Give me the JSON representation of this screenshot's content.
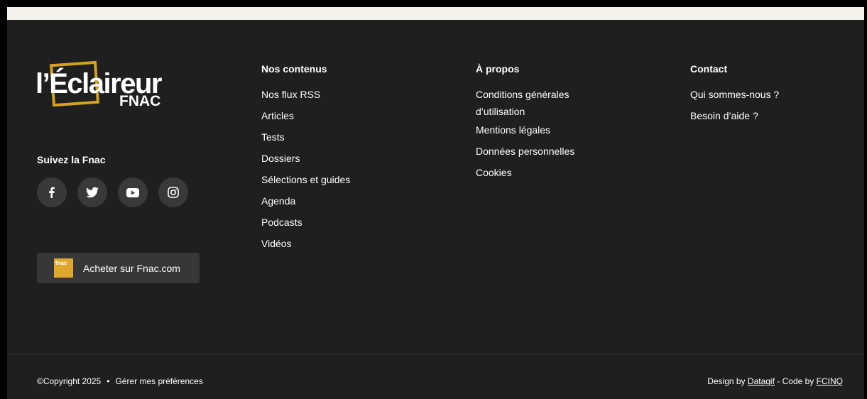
{
  "logo": {
    "main": "l’Éclaireur",
    "sub": "FNAC"
  },
  "follow": {
    "title": "Suivez la Fnac",
    "icons": [
      "facebook-icon",
      "twitter-icon",
      "youtube-icon",
      "instagram-icon"
    ]
  },
  "buy_button": {
    "badge": "fnac",
    "label": "Acheter sur Fnac.com"
  },
  "columns": {
    "contenus": {
      "title": "Nos contenus",
      "items": [
        "Nos flux RSS",
        "Articles",
        "Tests",
        "Dossiers",
        "Sélections et guides",
        "Agenda",
        "Podcasts",
        "Vidéos"
      ]
    },
    "apropos": {
      "title": "À propos",
      "items": [
        "Conditions générales d’utilisation",
        "Mentions légales",
        "Données personnelles",
        "Cookies"
      ]
    },
    "contact": {
      "title": "Contact",
      "items": [
        "Qui sommes-nous ?",
        "Besoin d’aide ?"
      ]
    }
  },
  "bottom": {
    "copyright": "©Copyright 2025",
    "separator": "•",
    "preferences": "Gérer mes préférences",
    "design_prefix": "Design by",
    "design_link": "Datagif",
    "code_prefix": "- Code by",
    "code_link": "FCINQ"
  },
  "colors": {
    "background": "#201f1f",
    "accent": "#d3a21f",
    "button": "#383737"
  }
}
